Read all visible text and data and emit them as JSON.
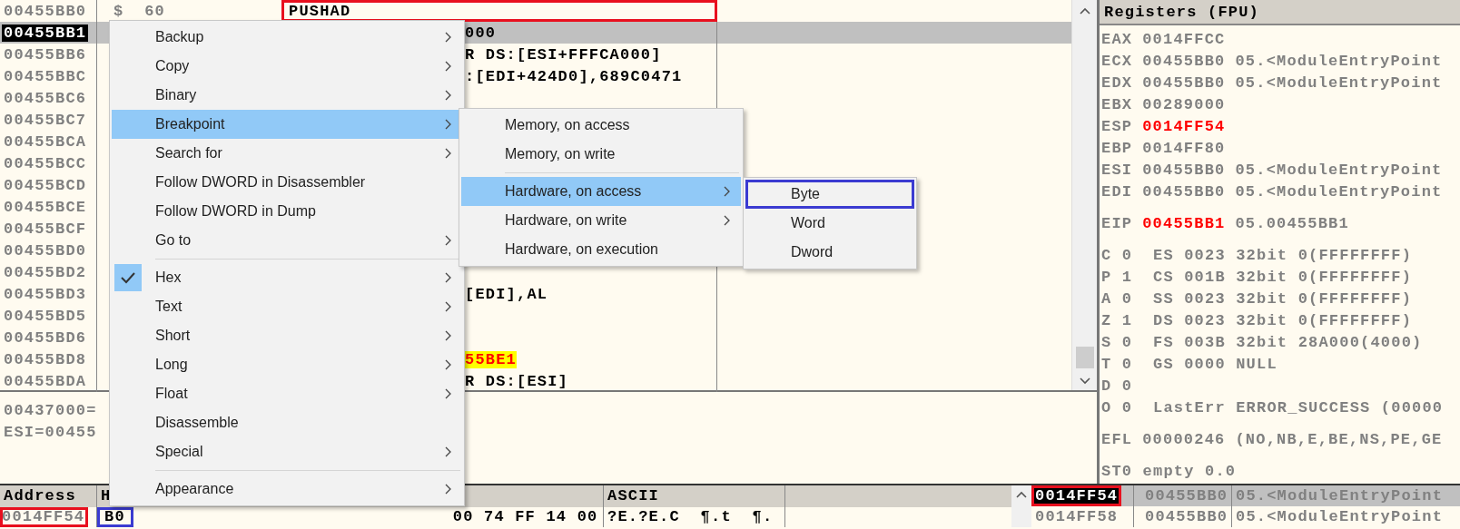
{
  "disassembly": {
    "rows": [
      {
        "address": "00455BB0",
        "bytes": "$  60",
        "instruction": "PUSHAD",
        "partial": false,
        "selected": false,
        "highlighted": false,
        "color": "#e8101e"
      },
      {
        "address": "00455BB1",
        "instruction": "000",
        "partial": true,
        "selected": true,
        "highlighted": false
      },
      {
        "address": "00455BB6",
        "instruction": "R DS:[ESI+FFFCA000]",
        "partial": true,
        "selected": false,
        "highlighted": false
      },
      {
        "address": "00455BBC",
        "instruction": ":[EDI+424D0],689C0471",
        "partial": true,
        "selected": false,
        "highlighted": false
      },
      {
        "address": "00455BC6",
        "selected": false
      },
      {
        "address": "00455BC7",
        "selected": false
      },
      {
        "address": "00455BCA",
        "selected": false
      },
      {
        "address": "00455BCC",
        "selected": false
      },
      {
        "address": "00455BCD",
        "selected": false
      },
      {
        "address": "00455BCE",
        "selected": false
      },
      {
        "address": "00455BCF",
        "selected": false
      },
      {
        "address": "00455BD0",
        "selected": false
      },
      {
        "address": "00455BD2",
        "selected": false
      },
      {
        "address": "00455BD3",
        "instruction": "[EDI],AL",
        "partial": true,
        "selected": false,
        "highlighted": false
      },
      {
        "address": "00455BD5",
        "selected": false
      },
      {
        "address": "00455BD6",
        "selected": false
      },
      {
        "address": "00455BD8",
        "instruction": "55BE1",
        "partial": true,
        "selected": false,
        "highlighted": true
      },
      {
        "address": "00455BDA",
        "instruction": "R DS:[ESI]",
        "partial": true,
        "selected": false,
        "highlighted": false
      }
    ]
  },
  "info": [
    "00437000=",
    "ESI=00455"
  ],
  "dump": {
    "headers": {
      "address": "Address",
      "hex": "H",
      "ascii": "ASCII"
    },
    "row": {
      "address": "0014FF54",
      "color": "#e8101e",
      "hex_first": {
        "text": "B0",
        "color": "#3b3bd1"
      },
      "hex_rest": "00 74 FF 14 00",
      "ascii": "?E.?E.C  ¶.t  ¶."
    }
  },
  "registers": {
    "title": "Registers (FPU)",
    "groups": [
      [
        {
          "kind": "reg",
          "name": "EAX",
          "value": "0014FFCC",
          "changed": false
        },
        {
          "kind": "reg",
          "name": "ECX",
          "value": "00455BB0",
          "changed": false,
          "comment": "05.<ModuleEntryPoint"
        },
        {
          "kind": "reg",
          "name": "EDX",
          "value": "00455BB0",
          "changed": false,
          "comment": "05.<ModuleEntryPoint"
        },
        {
          "kind": "reg",
          "name": "EBX",
          "value": "00289000",
          "changed": false
        },
        {
          "kind": "reg",
          "name": "ESP",
          "value": "0014FF54",
          "changed": true
        },
        {
          "kind": "reg",
          "name": "EBP",
          "value": "0014FF80",
          "changed": false
        },
        {
          "kind": "reg",
          "name": "ESI",
          "value": "00455BB0",
          "changed": false,
          "comment": "05.<ModuleEntryPoint"
        },
        {
          "kind": "reg",
          "name": "EDI",
          "value": "00455BB0",
          "changed": false,
          "comment": "05.<ModuleEntryPoint"
        }
      ],
      [
        {
          "kind": "reg",
          "name": "EIP",
          "value": "00455BB1",
          "changed": true,
          "comment": "05.00455BB1"
        }
      ],
      [
        {
          "kind": "text",
          "text": "C 0  ES 0023 32bit 0(FFFFFFFF)"
        },
        {
          "kind": "text",
          "text": "P 1  CS 001B 32bit 0(FFFFFFFF)"
        },
        {
          "kind": "text",
          "text": "A 0  SS 0023 32bit 0(FFFFFFFF)"
        },
        {
          "kind": "text",
          "text": "Z 1  DS 0023 32bit 0(FFFFFFFF)"
        },
        {
          "kind": "text",
          "text": "S 0  FS 003B 32bit 28A000(4000)"
        },
        {
          "kind": "text",
          "text": "T 0  GS 0000 NULL"
        },
        {
          "kind": "text",
          "text": "D 0"
        },
        {
          "kind": "text",
          "text": "O 0  LastErr ERROR_SUCCESS (00000"
        }
      ],
      [
        {
          "kind": "reg",
          "name": "EFL",
          "value": "00000246",
          "changed": false,
          "comment": "(NO,NB,E,BE,NS,PE,GE"
        }
      ],
      [
        {
          "kind": "text",
          "text": "ST0 empty 0.0"
        }
      ]
    ]
  },
  "stack": {
    "rows": [
      {
        "address": "0014FF54",
        "value": "00455BB0",
        "comment": "05.<ModuleEntryPoint",
        "selected": true,
        "color": "#e8101e"
      },
      {
        "address": "0014FF58",
        "value": "00455BB0",
        "comment": "05.<ModuleEntryPoint",
        "selected": false
      }
    ]
  },
  "context_menu": {
    "items": [
      {
        "kind": "item",
        "label": "Backup",
        "submenu": true,
        "selected": false,
        "checked": false
      },
      {
        "kind": "item",
        "label": "Copy",
        "submenu": true,
        "selected": false,
        "checked": false
      },
      {
        "kind": "item",
        "label": "Binary",
        "submenu": true,
        "selected": false,
        "checked": false
      },
      {
        "kind": "item",
        "label": "Breakpoint",
        "submenu": true,
        "selected": true,
        "checked": false
      },
      {
        "kind": "item",
        "label": "Search for",
        "submenu": true,
        "selected": false,
        "checked": false
      },
      {
        "kind": "item",
        "label": "Follow DWORD in Disassembler",
        "submenu": false,
        "selected": false,
        "checked": false
      },
      {
        "kind": "item",
        "label": "Follow DWORD in Dump",
        "submenu": false,
        "selected": false,
        "checked": false
      },
      {
        "kind": "item",
        "label": "Go to",
        "submenu": true,
        "selected": false,
        "checked": false
      },
      {
        "kind": "separator"
      },
      {
        "kind": "item",
        "label": "Hex",
        "submenu": true,
        "selected": false,
        "checked": true
      },
      {
        "kind": "item",
        "label": "Text",
        "submenu": true,
        "selected": false,
        "checked": false
      },
      {
        "kind": "item",
        "label": "Short",
        "submenu": true,
        "selected": false,
        "checked": false
      },
      {
        "kind": "item",
        "label": "Long",
        "submenu": true,
        "selected": false,
        "checked": false
      },
      {
        "kind": "item",
        "label": "Float",
        "submenu": true,
        "selected": false,
        "checked": false
      },
      {
        "kind": "item",
        "label": "Disassemble",
        "submenu": false,
        "selected": false,
        "checked": false
      },
      {
        "kind": "item",
        "label": "Special",
        "submenu": true,
        "selected": false,
        "checked": false
      },
      {
        "kind": "separator"
      },
      {
        "kind": "item",
        "label": "Appearance",
        "submenu": true,
        "selected": false,
        "checked": false
      }
    ]
  },
  "breakpoint_menu": {
    "items": [
      {
        "kind": "item",
        "label": "Memory, on access",
        "submenu": false,
        "selected": false
      },
      {
        "kind": "item",
        "label": "Memory, on write",
        "submenu": false,
        "selected": false
      },
      {
        "kind": "separator"
      },
      {
        "kind": "item",
        "label": "Hardware, on access",
        "submenu": true,
        "selected": true
      },
      {
        "kind": "item",
        "label": "Hardware, on write",
        "submenu": true,
        "selected": false
      },
      {
        "kind": "item",
        "label": "Hardware, on execution",
        "submenu": false,
        "selected": false
      }
    ]
  },
  "size_menu": {
    "items": [
      {
        "label": "Byte",
        "color": "#3b3bd1"
      },
      {
        "label": "Word"
      },
      {
        "label": "Dword"
      }
    ]
  }
}
